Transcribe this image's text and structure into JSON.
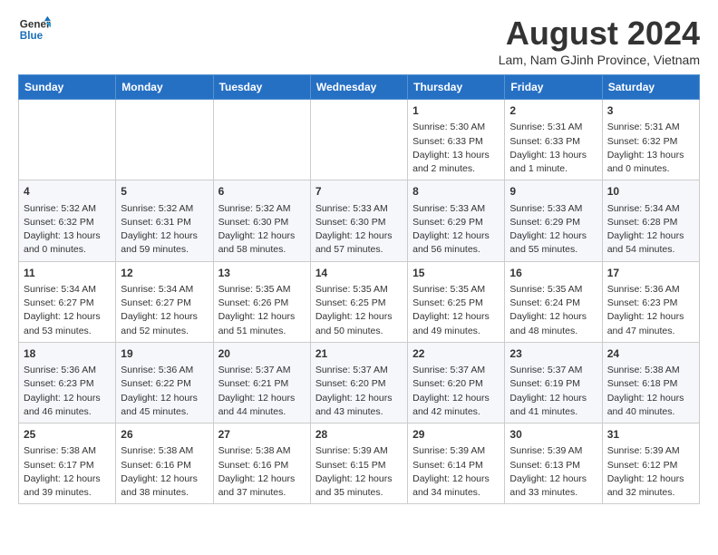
{
  "logo": {
    "line1": "General",
    "line2": "Blue"
  },
  "title": "August 2024",
  "subtitle": "Lam, Nam GJinh Province, Vietnam",
  "days_header": [
    "Sunday",
    "Monday",
    "Tuesday",
    "Wednesday",
    "Thursday",
    "Friday",
    "Saturday"
  ],
  "weeks": [
    [
      {
        "day": "",
        "content": ""
      },
      {
        "day": "",
        "content": ""
      },
      {
        "day": "",
        "content": ""
      },
      {
        "day": "",
        "content": ""
      },
      {
        "day": "1",
        "content": "Sunrise: 5:30 AM\nSunset: 6:33 PM\nDaylight: 13 hours\nand 2 minutes."
      },
      {
        "day": "2",
        "content": "Sunrise: 5:31 AM\nSunset: 6:33 PM\nDaylight: 13 hours\nand 1 minute."
      },
      {
        "day": "3",
        "content": "Sunrise: 5:31 AM\nSunset: 6:32 PM\nDaylight: 13 hours\nand 0 minutes."
      }
    ],
    [
      {
        "day": "4",
        "content": "Sunrise: 5:32 AM\nSunset: 6:32 PM\nDaylight: 13 hours\nand 0 minutes."
      },
      {
        "day": "5",
        "content": "Sunrise: 5:32 AM\nSunset: 6:31 PM\nDaylight: 12 hours\nand 59 minutes."
      },
      {
        "day": "6",
        "content": "Sunrise: 5:32 AM\nSunset: 6:30 PM\nDaylight: 12 hours\nand 58 minutes."
      },
      {
        "day": "7",
        "content": "Sunrise: 5:33 AM\nSunset: 6:30 PM\nDaylight: 12 hours\nand 57 minutes."
      },
      {
        "day": "8",
        "content": "Sunrise: 5:33 AM\nSunset: 6:29 PM\nDaylight: 12 hours\nand 56 minutes."
      },
      {
        "day": "9",
        "content": "Sunrise: 5:33 AM\nSunset: 6:29 PM\nDaylight: 12 hours\nand 55 minutes."
      },
      {
        "day": "10",
        "content": "Sunrise: 5:34 AM\nSunset: 6:28 PM\nDaylight: 12 hours\nand 54 minutes."
      }
    ],
    [
      {
        "day": "11",
        "content": "Sunrise: 5:34 AM\nSunset: 6:27 PM\nDaylight: 12 hours\nand 53 minutes."
      },
      {
        "day": "12",
        "content": "Sunrise: 5:34 AM\nSunset: 6:27 PM\nDaylight: 12 hours\nand 52 minutes."
      },
      {
        "day": "13",
        "content": "Sunrise: 5:35 AM\nSunset: 6:26 PM\nDaylight: 12 hours\nand 51 minutes."
      },
      {
        "day": "14",
        "content": "Sunrise: 5:35 AM\nSunset: 6:25 PM\nDaylight: 12 hours\nand 50 minutes."
      },
      {
        "day": "15",
        "content": "Sunrise: 5:35 AM\nSunset: 6:25 PM\nDaylight: 12 hours\nand 49 minutes."
      },
      {
        "day": "16",
        "content": "Sunrise: 5:35 AM\nSunset: 6:24 PM\nDaylight: 12 hours\nand 48 minutes."
      },
      {
        "day": "17",
        "content": "Sunrise: 5:36 AM\nSunset: 6:23 PM\nDaylight: 12 hours\nand 47 minutes."
      }
    ],
    [
      {
        "day": "18",
        "content": "Sunrise: 5:36 AM\nSunset: 6:23 PM\nDaylight: 12 hours\nand 46 minutes."
      },
      {
        "day": "19",
        "content": "Sunrise: 5:36 AM\nSunset: 6:22 PM\nDaylight: 12 hours\nand 45 minutes."
      },
      {
        "day": "20",
        "content": "Sunrise: 5:37 AM\nSunset: 6:21 PM\nDaylight: 12 hours\nand 44 minutes."
      },
      {
        "day": "21",
        "content": "Sunrise: 5:37 AM\nSunset: 6:20 PM\nDaylight: 12 hours\nand 43 minutes."
      },
      {
        "day": "22",
        "content": "Sunrise: 5:37 AM\nSunset: 6:20 PM\nDaylight: 12 hours\nand 42 minutes."
      },
      {
        "day": "23",
        "content": "Sunrise: 5:37 AM\nSunset: 6:19 PM\nDaylight: 12 hours\nand 41 minutes."
      },
      {
        "day": "24",
        "content": "Sunrise: 5:38 AM\nSunset: 6:18 PM\nDaylight: 12 hours\nand 40 minutes."
      }
    ],
    [
      {
        "day": "25",
        "content": "Sunrise: 5:38 AM\nSunset: 6:17 PM\nDaylight: 12 hours\nand 39 minutes."
      },
      {
        "day": "26",
        "content": "Sunrise: 5:38 AM\nSunset: 6:16 PM\nDaylight: 12 hours\nand 38 minutes."
      },
      {
        "day": "27",
        "content": "Sunrise: 5:38 AM\nSunset: 6:16 PM\nDaylight: 12 hours\nand 37 minutes."
      },
      {
        "day": "28",
        "content": "Sunrise: 5:39 AM\nSunset: 6:15 PM\nDaylight: 12 hours\nand 35 minutes."
      },
      {
        "day": "29",
        "content": "Sunrise: 5:39 AM\nSunset: 6:14 PM\nDaylight: 12 hours\nand 34 minutes."
      },
      {
        "day": "30",
        "content": "Sunrise: 5:39 AM\nSunset: 6:13 PM\nDaylight: 12 hours\nand 33 minutes."
      },
      {
        "day": "31",
        "content": "Sunrise: 5:39 AM\nSunset: 6:12 PM\nDaylight: 12 hours\nand 32 minutes."
      }
    ]
  ]
}
